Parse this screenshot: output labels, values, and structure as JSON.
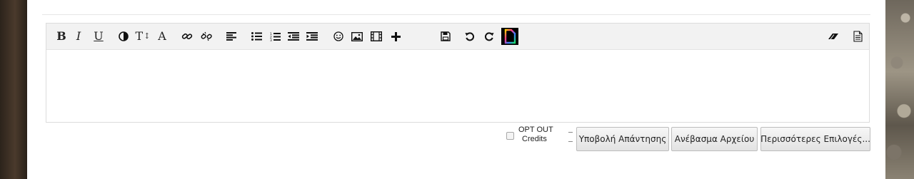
{
  "toolbar": {
    "bold_label": "B",
    "italic_label": "I",
    "underline_label": "U",
    "fontsize_label": "T",
    "font_label": "A",
    "buttons": [
      {
        "name": "bold-icon"
      },
      {
        "name": "italic-icon"
      },
      {
        "name": "underline-icon"
      },
      {
        "name": "color-contrast-icon"
      },
      {
        "name": "font-size-icon"
      },
      {
        "name": "font-face-icon"
      },
      {
        "name": "link-icon"
      },
      {
        "name": "unlink-icon"
      },
      {
        "name": "align-left-icon"
      },
      {
        "name": "bullet-list-icon"
      },
      {
        "name": "numbered-list-icon"
      },
      {
        "name": "outdent-icon"
      },
      {
        "name": "indent-icon"
      },
      {
        "name": "smiley-icon"
      },
      {
        "name": "image-icon"
      },
      {
        "name": "video-icon"
      },
      {
        "name": "plus-icon"
      },
      {
        "name": "save-icon"
      },
      {
        "name": "undo-icon"
      },
      {
        "name": "redo-icon"
      },
      {
        "name": "document-icon"
      },
      {
        "name": "eraser-icon"
      },
      {
        "name": "source-document-icon"
      }
    ]
  },
  "optout": {
    "checked": false,
    "line1": "OPT OUT",
    "line2": "Credits"
  },
  "actions": {
    "submit_reply": "Υποβολή Απάντησης",
    "upload_file": "Ανέβασμα Αρχείου",
    "more_options": "Περισσότερες Επιλογές..."
  },
  "colors": {
    "toolbar_bg": "#f2f2f2",
    "button_bg": "#e9e9e9",
    "page_bg": "#ffffff"
  }
}
